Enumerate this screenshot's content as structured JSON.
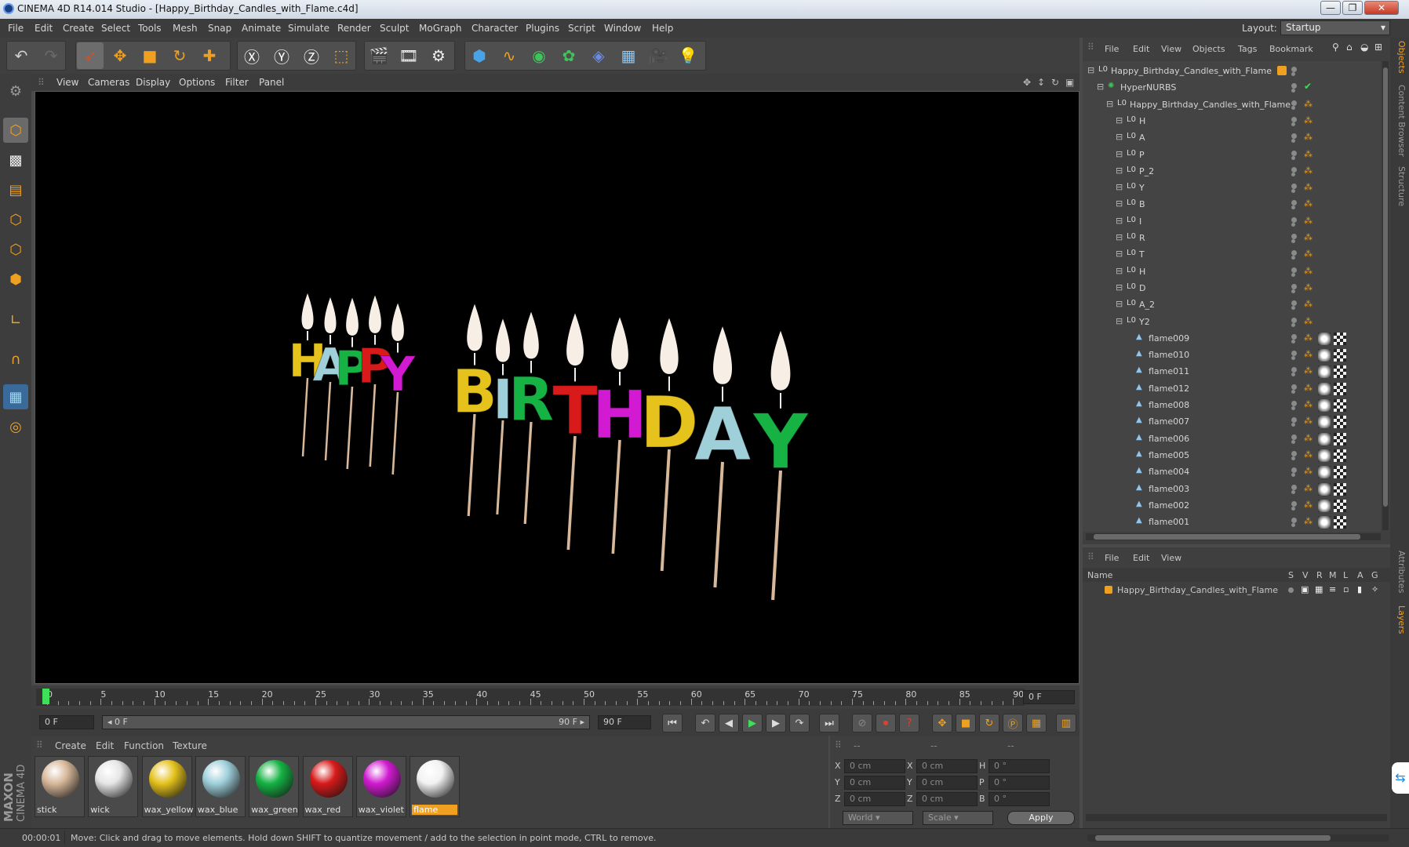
{
  "window": {
    "title": "CINEMA 4D R14.014 Studio - [Happy_Birthday_Candles_with_Flame.c4d]",
    "minimize": "—",
    "maximize": "❐",
    "close": "✕"
  },
  "menubar": {
    "items": [
      "File",
      "Edit",
      "Create",
      "Select",
      "Tools",
      "Mesh",
      "Snap",
      "Animate",
      "Simulate",
      "Render",
      "Sculpt",
      "MoGraph",
      "Character",
      "Plugins",
      "Script",
      "Window",
      "Help"
    ],
    "layout_label": "Layout:",
    "layout_value": "Startup"
  },
  "viewport": {
    "menu": [
      "View",
      "Cameras",
      "Display",
      "Options",
      "Filter",
      "Panel"
    ],
    "letters_happy": [
      "H",
      "A",
      "P",
      "P",
      "Y"
    ],
    "letters_birthday": [
      "B",
      "I",
      "R",
      "T",
      "H",
      "D",
      "A",
      "Y"
    ]
  },
  "timeline": {
    "ticks": [
      "0",
      "5",
      "10",
      "15",
      "20",
      "25",
      "30",
      "35",
      "40",
      "45",
      "50",
      "55",
      "60",
      "65",
      "70",
      "75",
      "80",
      "85",
      "90"
    ],
    "current_frame": "0 F"
  },
  "transport": {
    "start_field": "0 F",
    "range_start": "◂ 0 F",
    "range_end": "90 F ▸",
    "end_field": "90 F"
  },
  "materials": {
    "menu": [
      "Create",
      "Edit",
      "Function",
      "Texture"
    ],
    "items": [
      {
        "label": "stick",
        "color": "#d8b89a"
      },
      {
        "label": "wick",
        "color": "#e6e6e6"
      },
      {
        "label": "wax_yellow",
        "color": "#e5c21c"
      },
      {
        "label": "wax_blue",
        "color": "#9fd0da"
      },
      {
        "label": "wax_green",
        "color": "#16b344"
      },
      {
        "label": "wax_red",
        "color": "#d81a1a"
      },
      {
        "label": "wax_violet",
        "color": "#d11ad1"
      },
      {
        "label": "flame",
        "color": "#f2f2f2"
      }
    ],
    "selected": "flame",
    "brand_top": "MAXON",
    "brand_bottom": "CINEMA 4D"
  },
  "coords": {
    "headers": [
      "--",
      "--",
      "--"
    ],
    "rows": [
      {
        "a": "X",
        "av": "0 cm",
        "b": "X",
        "bv": "0 cm",
        "c": "H",
        "cv": "0 °"
      },
      {
        "a": "Y",
        "av": "0 cm",
        "b": "Y",
        "bv": "0 cm",
        "c": "P",
        "cv": "0 °"
      },
      {
        "a": "Z",
        "av": "0 cm",
        "b": "Z",
        "bv": "0 cm",
        "c": "B",
        "cv": "0 °"
      }
    ],
    "world": "World",
    "scale": "Scale",
    "apply": "Apply"
  },
  "object_manager": {
    "menu": [
      "File",
      "Edit",
      "View",
      "Objects",
      "Tags",
      "Bookmark"
    ],
    "root": "Happy_Birthday_Candles_with_Flame",
    "hypernurbs": "HyperNURBS",
    "null": "Happy_Birthday_Candles_with_Flame",
    "letters": [
      "H",
      "A",
      "P",
      "P_2",
      "Y",
      "B",
      "I",
      "R",
      "T",
      "H",
      "D",
      "A_2",
      "Y2"
    ],
    "flames": [
      "flame009",
      "flame010",
      "flame011",
      "flame012",
      "flame008",
      "flame007",
      "flame006",
      "flame005",
      "flame004",
      "flame003",
      "flame002",
      "flame001"
    ]
  },
  "layer_manager": {
    "menu": [
      "File",
      "Edit",
      "View"
    ],
    "col_name": "Name",
    "cols": [
      "S",
      "V",
      "R",
      "M",
      "L",
      "A",
      "G"
    ],
    "layer": "Happy_Birthday_Candles_with_Flame"
  },
  "right_tabs": [
    "Objects",
    "Content Browser",
    "Structure",
    "Attributes",
    "Layers"
  ],
  "status": {
    "time": "00:00:01",
    "message": "Move: Click and drag to move elements. Hold down SHIFT to quantize movement / add to the selection in point mode, CTRL to remove."
  }
}
